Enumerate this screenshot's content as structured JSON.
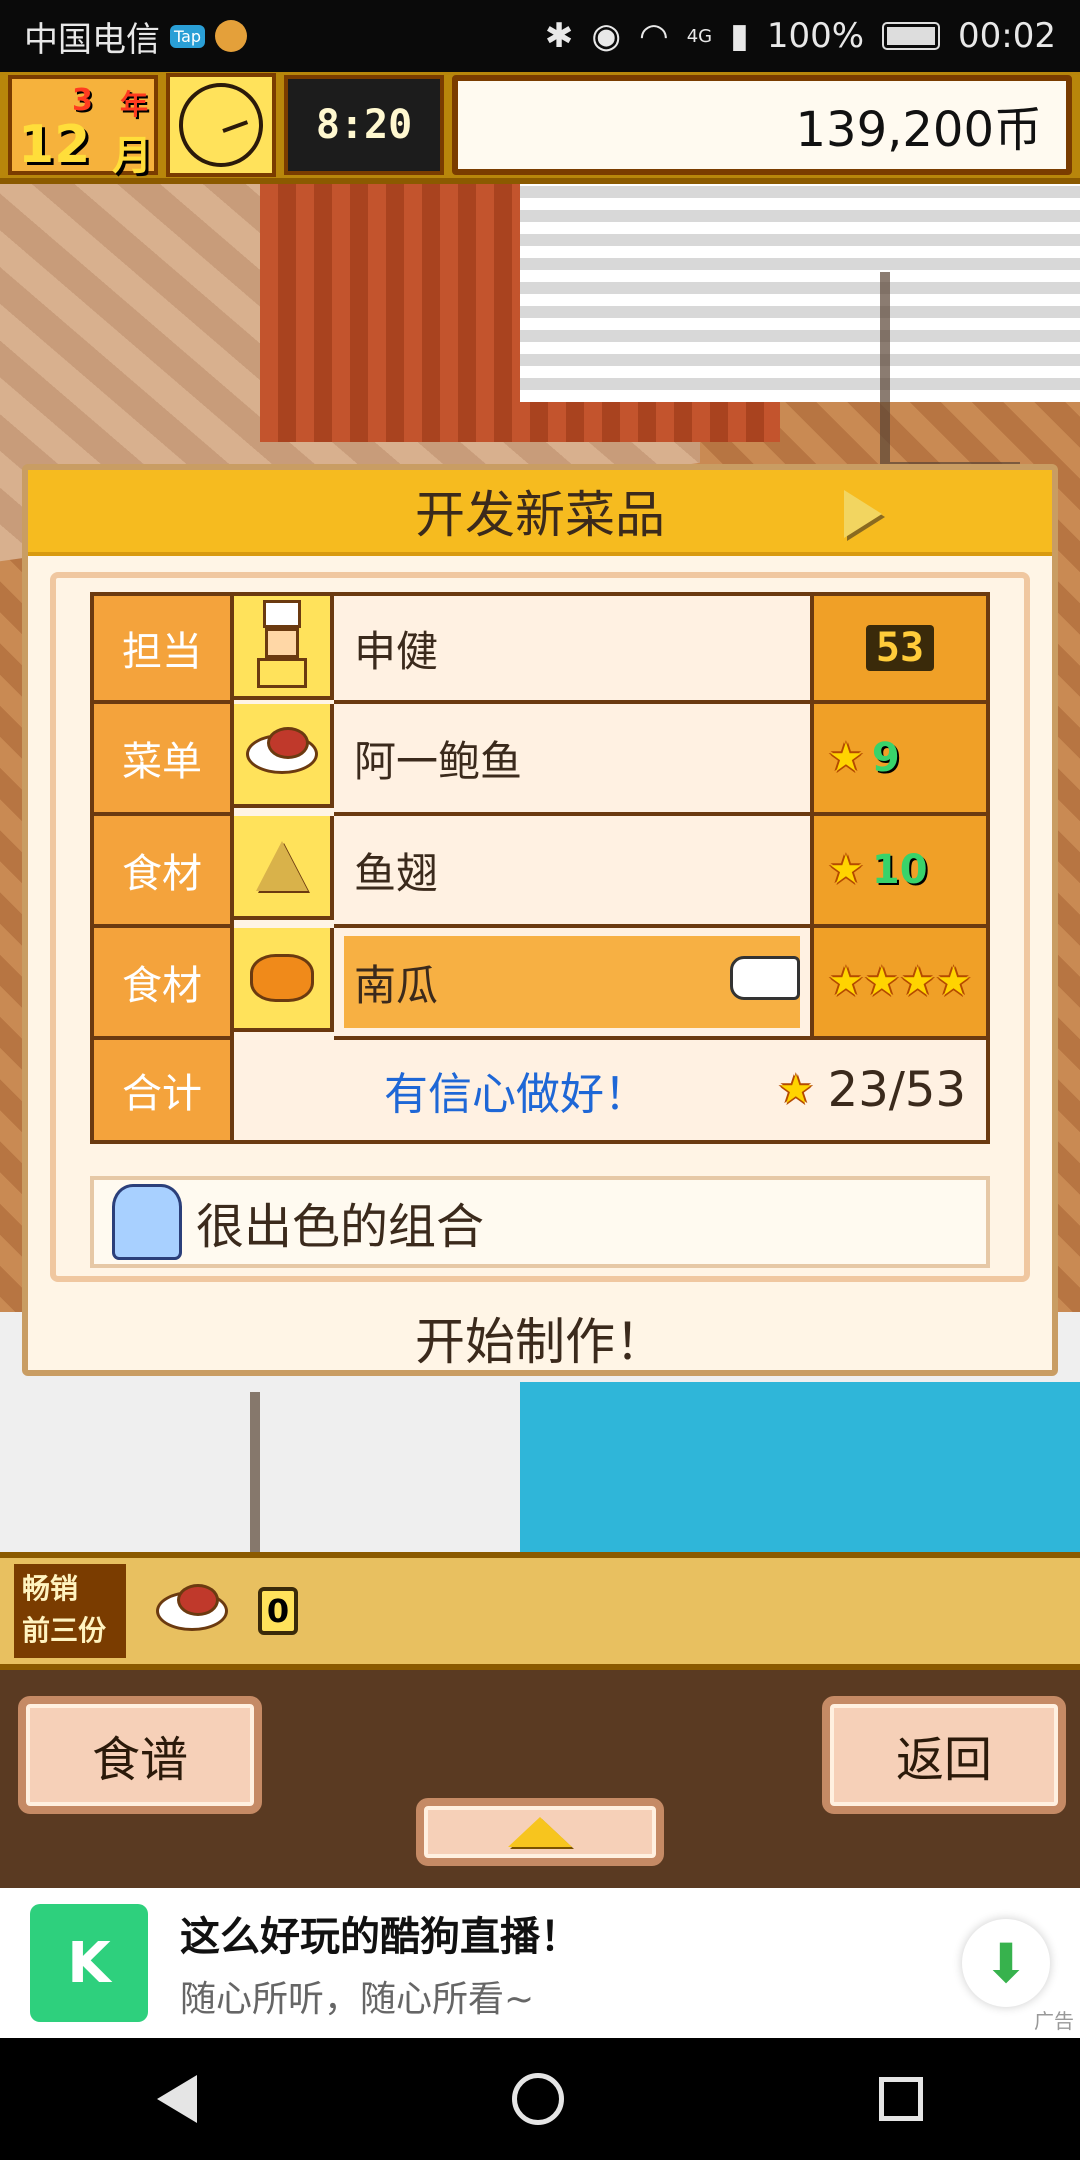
{
  "status_bar": {
    "carrier": "中国电信",
    "tap_badge": "Tap",
    "battery": "100%",
    "time": "00:02",
    "network": "4G"
  },
  "hud": {
    "year_num": "3",
    "year_suffix": "年",
    "month_num": "12",
    "month_suffix": "月",
    "time": "8:20",
    "money": "139,200币"
  },
  "dialog": {
    "title": "开发新菜品",
    "rows": [
      {
        "label": "担当",
        "name": "申健",
        "stat": "53"
      },
      {
        "label": "菜单",
        "name": "阿一鲍鱼",
        "stat": "9"
      },
      {
        "label": "食材",
        "name": "鱼翅",
        "stat": "10"
      },
      {
        "label": "食材",
        "name": "南瓜",
        "stat": "★★★★"
      }
    ],
    "total_label": "合计",
    "confidence_text": "有信心做好！",
    "score": "23/53",
    "hint": "很出色的组合",
    "start_button": "开始制作！"
  },
  "bestseller": {
    "label_line1": "畅销",
    "label_line2": "前三份",
    "count": "0"
  },
  "controls": {
    "recipes": "食谱",
    "back": "返回"
  },
  "ad": {
    "title": "这么好玩的酷狗直播！",
    "subtitle": "随心所听，随心所看~",
    "tag": "广告",
    "logo_letter": "K"
  },
  "colors": {
    "header": "#f6bb1f",
    "label_orange": "#f4a33c",
    "confidence_blue": "#1e67d6"
  }
}
